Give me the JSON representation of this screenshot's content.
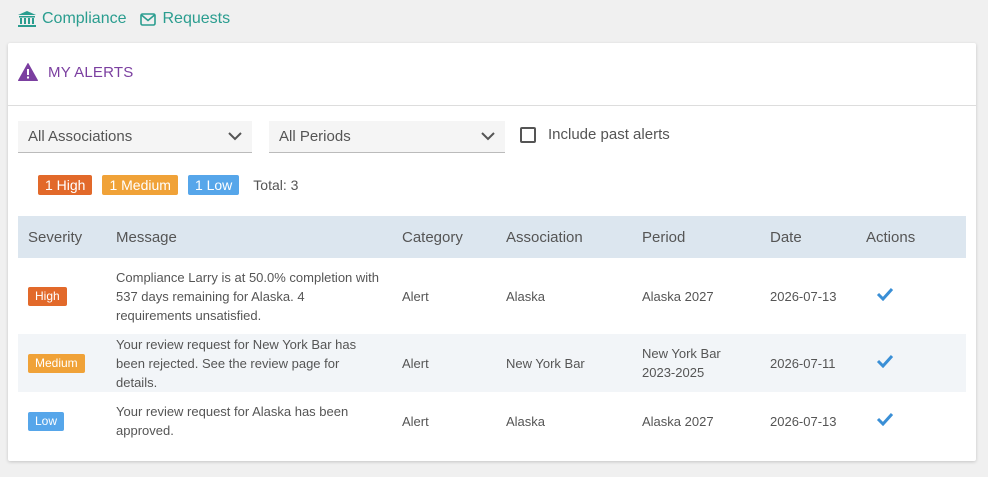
{
  "nav": {
    "compliance_label": "Compliance",
    "requests_label": "Requests"
  },
  "panel": {
    "title": "MY ALERTS"
  },
  "filters": {
    "association_selected": "All Associations",
    "period_selected": "All Periods",
    "include_past_label": "Include past alerts",
    "include_past_checked": false
  },
  "summary": {
    "high": "1 High",
    "medium": "1 Medium",
    "low": "1 Low",
    "total": "Total: 3"
  },
  "colors": {
    "accent": "#2a9d8f",
    "title_purple": "#7b3fa0",
    "high": "#e2692a",
    "medium": "#f0a238",
    "low": "#56a6ea",
    "check": "#3a8fd6"
  },
  "table": {
    "columns": [
      "Severity",
      "Message",
      "Category",
      "Association",
      "Period",
      "Date",
      "Actions"
    ],
    "rows": [
      {
        "severity": "High",
        "message": "Compliance Larry is at 50.0% completion with 537 days remaining for Alaska. 4 requirements unsatisfied.",
        "category": "Alert",
        "association": "Alaska",
        "period": "Alaska 2027",
        "date": "2026-07-13",
        "action_icon": "checkmark-icon"
      },
      {
        "severity": "Medium",
        "message": "Your review request for New York Bar has been rejected. See the review page for details.",
        "category": "Alert",
        "association": "New York Bar",
        "period": "New York Bar 2023-2025",
        "date": "2026-07-11",
        "action_icon": "checkmark-icon"
      },
      {
        "severity": "Low",
        "message": "Your review request for Alaska has been approved.",
        "category": "Alert",
        "association": "Alaska",
        "period": "Alaska 2027",
        "date": "2026-07-13",
        "action_icon": "checkmark-icon"
      }
    ]
  }
}
